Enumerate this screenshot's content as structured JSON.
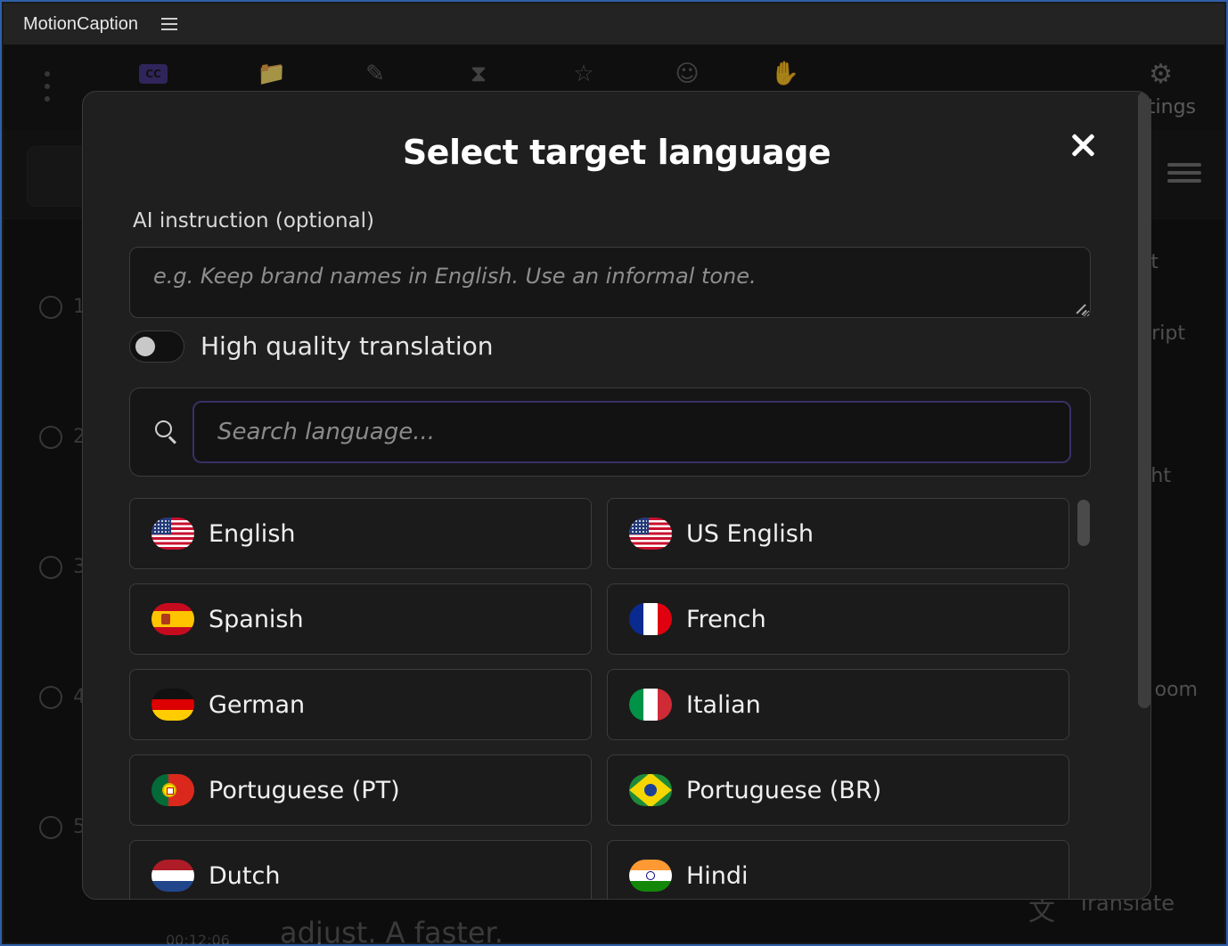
{
  "app": {
    "title": "MotionCaption"
  },
  "background": {
    "settings_label": "tings",
    "side_labels": [
      "t",
      "ript",
      "ht",
      "oom"
    ],
    "row_numbers": [
      "1",
      "2",
      "3",
      "4",
      "5"
    ],
    "bottom_text": "adjust. A faster.",
    "timestamp": "00:12:06",
    "translate_label": "Translate",
    "cc_label": "CC"
  },
  "modal": {
    "title": "Select target language",
    "instruction_label": "AI instruction (optional)",
    "instruction_placeholder": "e.g. Keep brand names in English. Use an informal tone.",
    "instruction_value": "",
    "hq_toggle_label": "High quality translation",
    "hq_toggle_on": false,
    "search_placeholder": "Search language...",
    "search_value": ""
  },
  "languages": [
    {
      "label": "English",
      "flag": "us-flag-icon"
    },
    {
      "label": "US English",
      "flag": "us-flag-icon"
    },
    {
      "label": "Spanish",
      "flag": "spain-flag-icon"
    },
    {
      "label": "French",
      "flag": "france-flag-icon"
    },
    {
      "label": "German",
      "flag": "germany-flag-icon"
    },
    {
      "label": "Italian",
      "flag": "italy-flag-icon"
    },
    {
      "label": "Portuguese (PT)",
      "flag": "portugal-flag-icon"
    },
    {
      "label": "Portuguese (BR)",
      "flag": "brazil-flag-icon"
    },
    {
      "label": "Dutch",
      "flag": "netherlands-flag-icon"
    },
    {
      "label": "Hindi",
      "flag": "india-flag-icon"
    }
  ],
  "colors": {
    "accent_border": "#3a2f66",
    "window_border": "#2f5fa8",
    "modal_bg": "#1f1f1f"
  }
}
